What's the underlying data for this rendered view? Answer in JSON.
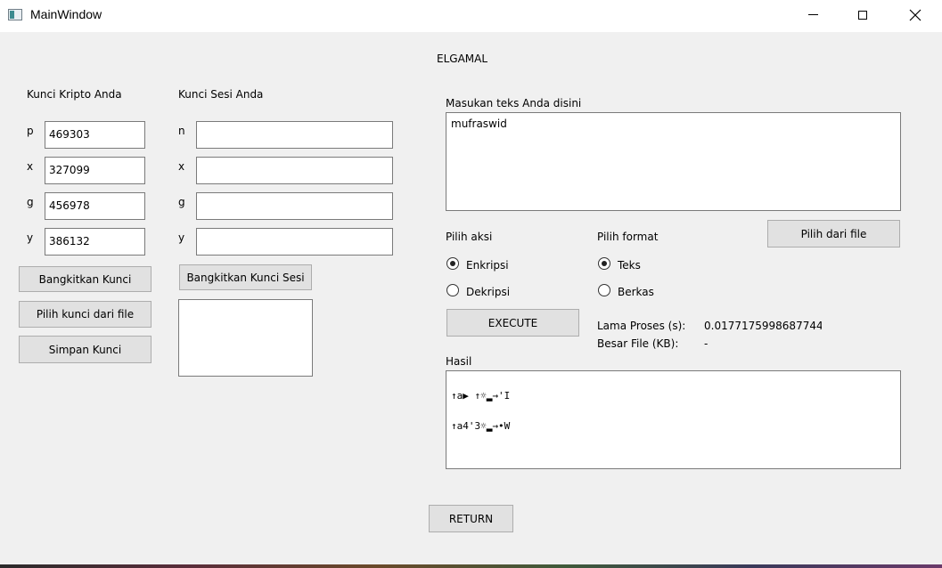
{
  "window": {
    "title": "MainWindow"
  },
  "header": {
    "title": "ELGAMAL"
  },
  "crypto_key": {
    "title": "Kunci Kripto Anda",
    "fields": [
      {
        "label": "p",
        "value": "469303"
      },
      {
        "label": "x",
        "value": "327099"
      },
      {
        "label": "g",
        "value": "456978"
      },
      {
        "label": "y",
        "value": "386132"
      }
    ],
    "generate_label": "Bangkitkan Kunci",
    "load_label": "Pilih kunci dari file",
    "save_label": "Simpan Kunci"
  },
  "session_key": {
    "title": "Kunci Sesi Anda",
    "fields": [
      {
        "label": "n",
        "value": ""
      },
      {
        "label": "x",
        "value": ""
      },
      {
        "label": "g",
        "value": ""
      },
      {
        "label": "y",
        "value": ""
      }
    ],
    "generate_label": "Bangkitkan Kunci Sesi",
    "output_value": ""
  },
  "input": {
    "label": "Masukan teks Anda disini",
    "value": "mufraswid",
    "file_button_label": "Pilih dari file"
  },
  "action": {
    "label": "Pilih aksi",
    "options": [
      {
        "label": "Enkripsi",
        "checked": true
      },
      {
        "label": "Dekripsi",
        "checked": false
      }
    ]
  },
  "format": {
    "label": "Pilih format",
    "options": [
      {
        "label": "Teks",
        "checked": true
      },
      {
        "label": "Berkas",
        "checked": false
      }
    ]
  },
  "execute_label": "EXECUTE",
  "stats": {
    "duration_label": "Lama Proses (s):",
    "duration_value": "0.01771759986877441",
    "size_label": "Besar File (KB):",
    "size_value": "-"
  },
  "result": {
    "label": "Hasil",
    "lines": [
      "↑a▶        ↑☼▂→'I",
      "↑a4'3☼▂→•W"
    ]
  },
  "return_label": "RETURN"
}
